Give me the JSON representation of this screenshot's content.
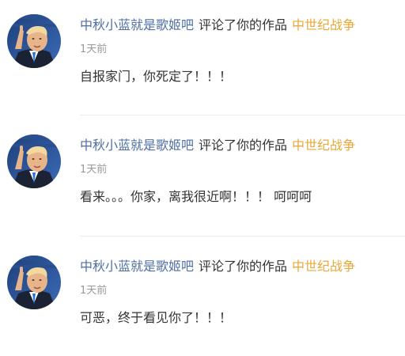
{
  "notifications": [
    {
      "avatar_icon": "user-avatar-photo",
      "username": "中秋小蓝就是歌姬吧",
      "action": "评论了你的作品",
      "work_title": "中世纪战争",
      "time": "1天前",
      "content": "自报家门，你死定了！！！"
    },
    {
      "avatar_icon": "user-avatar-photo",
      "username": "中秋小蓝就是歌姬吧",
      "action": "评论了你的作品",
      "work_title": "中世纪战争",
      "time": "1天前",
      "content": "看来。。。你家，离我很近啊！！！ 呵呵呵"
    },
    {
      "avatar_icon": "user-avatar-photo",
      "username": "中秋小蓝就是歌姬吧",
      "action": "评论了你的作品",
      "work_title": "中世纪战争",
      "time": "1天前",
      "content": "可恶，终于看见你了！！！"
    }
  ],
  "colors": {
    "username": "#4e6fa3",
    "action": "#333333",
    "work_title": "#e8a93a",
    "time": "#9a9a9a",
    "divider": "#ececec"
  }
}
